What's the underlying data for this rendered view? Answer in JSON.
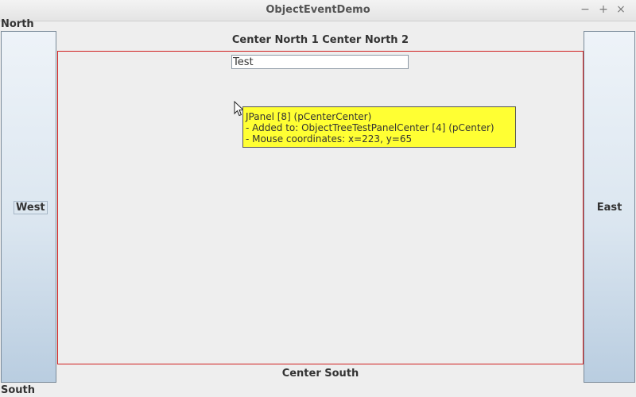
{
  "window": {
    "title": "ObjectEventDemo",
    "controls": {
      "minimize": "−",
      "maximize": "+",
      "close": "×"
    }
  },
  "labels": {
    "north": "North",
    "south": "South",
    "west": "West",
    "east": "East",
    "center_north": "Center North 1 Center North 2",
    "center_south": "Center South"
  },
  "text_field": {
    "value": "Test"
  },
  "tooltip": {
    "lines": [
      "JPanel [8]  (pCenterCenter)",
      " - Added to: ObjectTreeTestPanelCenter [4]  (pCenter)",
      " - Mouse coordinates: x=223, y=65"
    ]
  },
  "colors": {
    "center_border": "#d02020",
    "tooltip_bg": "#ffff33"
  },
  "icons": {
    "cursor": "mouse-pointer-icon"
  }
}
